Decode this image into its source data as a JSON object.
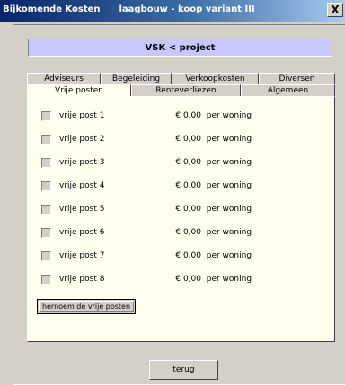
{
  "window": {
    "title_left": "Bijkomende Kosten",
    "title_right": "laagbouw - koop variant III",
    "close_symbol": "X"
  },
  "header": {
    "label": "VSK < project",
    "background_color": "#c8c8ff"
  },
  "tabs": {
    "row1": [
      "Adviseurs",
      "Begeleiding",
      "Verkoopkosten",
      "Diversen"
    ],
    "row2": [
      "Vrije posten",
      "Renteverliezen",
      "Algemeen"
    ],
    "selected": "Vrije posten"
  },
  "posts": [
    {
      "label": "vrije post 1",
      "amount": "€ 0,00",
      "unit": "per woning"
    },
    {
      "label": "vrije post 2",
      "amount": "€ 0,00",
      "unit": "per woning"
    },
    {
      "label": "vrije post 3",
      "amount": "€ 0,00",
      "unit": "per woning"
    },
    {
      "label": "vrije post 4",
      "amount": "€ 0,00",
      "unit": "per woning"
    },
    {
      "label": "vrije post 5",
      "amount": "€ 0,00",
      "unit": "per woning"
    },
    {
      "label": "vrije post 6",
      "amount": "€ 0,00",
      "unit": "per woning"
    },
    {
      "label": "vrije post 7",
      "amount": "€ 0,00",
      "unit": "per woning"
    },
    {
      "label": "vrije post 8",
      "amount": "€ 0,00",
      "unit": "per woning"
    }
  ],
  "buttons": {
    "rename": "hernoem de vrije posten",
    "back": "terug"
  }
}
